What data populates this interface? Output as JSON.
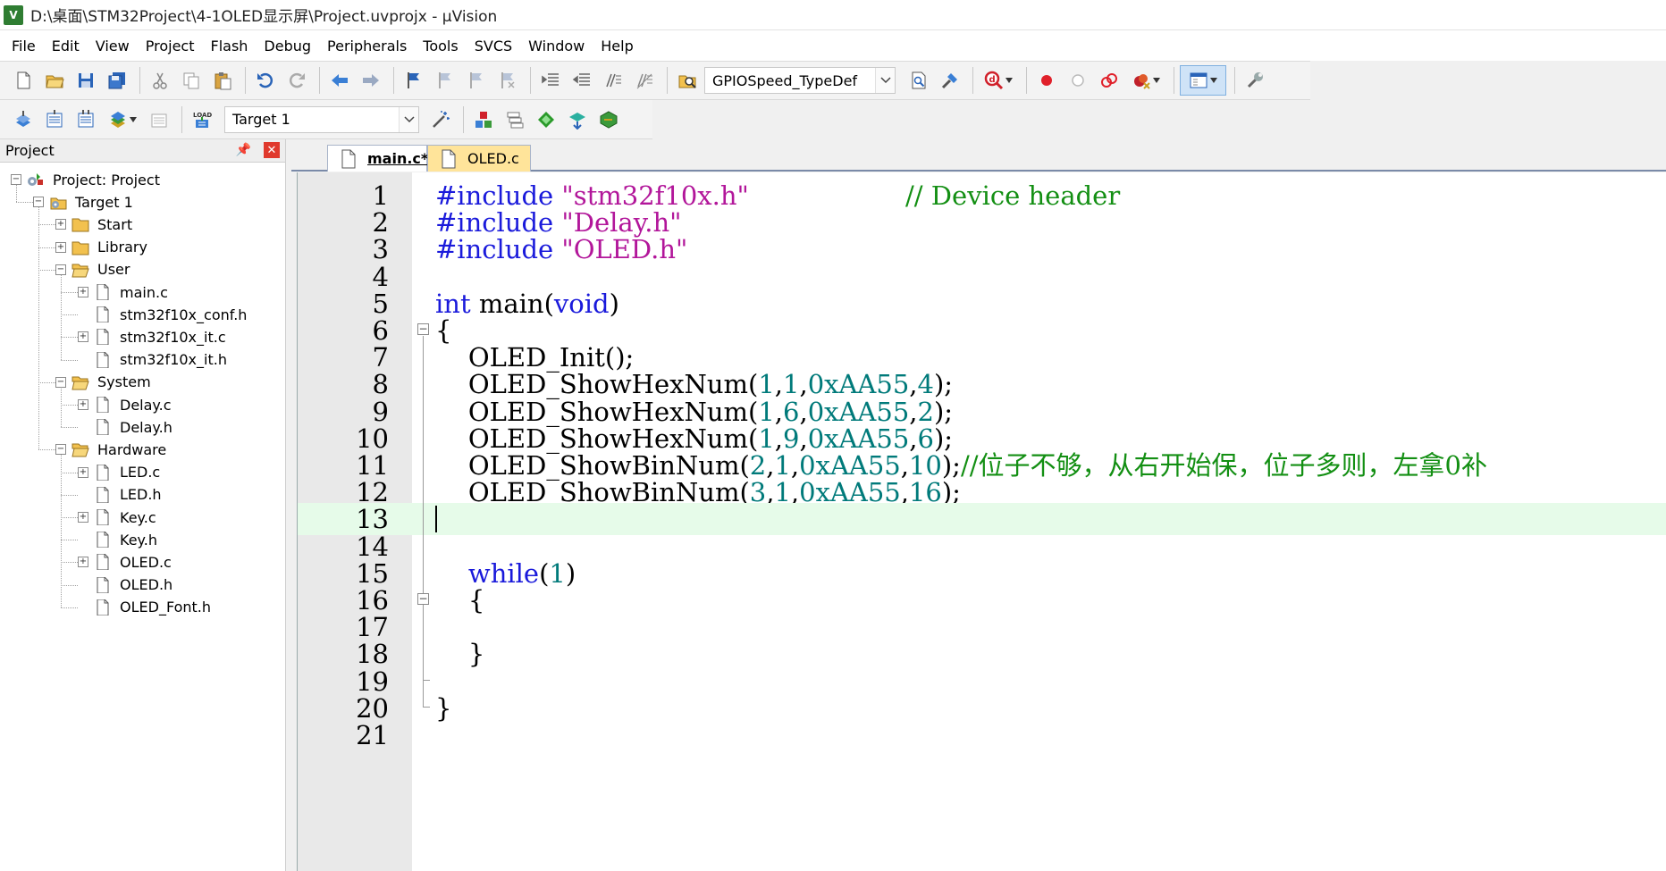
{
  "window": {
    "logo_text": "V",
    "title": "D:\\桌面\\STM32Project\\4-1OLED显示屏\\Project.uvprojx - µVision"
  },
  "menu": [
    "File",
    "Edit",
    "View",
    "Project",
    "Flash",
    "Debug",
    "Peripherals",
    "Tools",
    "SVCS",
    "Window",
    "Help"
  ],
  "toolbar": {
    "find_combo_value": "GPIOSpeed_TypeDef",
    "target_combo_value": "Target 1"
  },
  "project_panel": {
    "title": "Project",
    "close": "✕",
    "tree": [
      {
        "label": "Project: Project",
        "level": 0,
        "type": "project",
        "expander": "−"
      },
      {
        "label": "Target 1",
        "level": 1,
        "type": "target",
        "expander": "−"
      },
      {
        "label": "Start",
        "level": 2,
        "type": "folder",
        "expander": "+"
      },
      {
        "label": "Library",
        "level": 2,
        "type": "folder",
        "expander": "+"
      },
      {
        "label": "User",
        "level": 2,
        "type": "folder-open",
        "expander": "−"
      },
      {
        "label": "main.c",
        "level": 3,
        "type": "file",
        "expander": "+"
      },
      {
        "label": "stm32f10x_conf.h",
        "level": 3,
        "type": "file",
        "expander": ""
      },
      {
        "label": "stm32f10x_it.c",
        "level": 3,
        "type": "file",
        "expander": "+"
      },
      {
        "label": "stm32f10x_it.h",
        "level": 3,
        "type": "file",
        "expander": ""
      },
      {
        "label": "System",
        "level": 2,
        "type": "folder-open",
        "expander": "−"
      },
      {
        "label": "Delay.c",
        "level": 3,
        "type": "file",
        "expander": "+"
      },
      {
        "label": "Delay.h",
        "level": 3,
        "type": "file",
        "expander": ""
      },
      {
        "label": "Hardware",
        "level": 2,
        "type": "folder-open",
        "expander": "−"
      },
      {
        "label": "LED.c",
        "level": 3,
        "type": "file",
        "expander": "+"
      },
      {
        "label": "LED.h",
        "level": 3,
        "type": "file",
        "expander": ""
      },
      {
        "label": "Key.c",
        "level": 3,
        "type": "file",
        "expander": "+"
      },
      {
        "label": "Key.h",
        "level": 3,
        "type": "file",
        "expander": ""
      },
      {
        "label": "OLED.c",
        "level": 3,
        "type": "file",
        "expander": "+"
      },
      {
        "label": "OLED.h",
        "level": 3,
        "type": "file",
        "expander": ""
      },
      {
        "label": "OLED_Font.h",
        "level": 3,
        "type": "file",
        "expander": ""
      }
    ]
  },
  "editor": {
    "tabs": [
      {
        "label": "main.c*",
        "active": true
      },
      {
        "label": "OLED.c",
        "active": false
      }
    ],
    "current_line": 13,
    "lines": [
      [
        [
          "pp",
          "#include "
        ],
        [
          "str",
          "\"stm32f10x.h\""
        ],
        [
          "cmt",
          "                   // Device header"
        ]
      ],
      [
        [
          "pp",
          "#include "
        ],
        [
          "str",
          "\"Delay.h\""
        ]
      ],
      [
        [
          "pp",
          "#include "
        ],
        [
          "str",
          "\"OLED.h\""
        ]
      ],
      [],
      [
        [
          "kw",
          "int"
        ],
        [
          "fn",
          " main"
        ],
        [
          "op",
          "("
        ],
        [
          "kw",
          "void"
        ],
        [
          "op",
          ")"
        ]
      ],
      [
        [
          "op",
          "{"
        ]
      ],
      [
        [
          "fn",
          "    OLED_Init"
        ],
        [
          "op",
          "();"
        ]
      ],
      [
        [
          "fn",
          "    OLED_ShowHexNum"
        ],
        [
          "op",
          "("
        ],
        [
          "num",
          "1"
        ],
        [
          "op",
          ","
        ],
        [
          "num",
          "1"
        ],
        [
          "op",
          ","
        ],
        [
          "num",
          "0xAA55"
        ],
        [
          "op",
          ","
        ],
        [
          "num",
          "4"
        ],
        [
          "op",
          ");"
        ]
      ],
      [
        [
          "fn",
          "    OLED_ShowHexNum"
        ],
        [
          "op",
          "("
        ],
        [
          "num",
          "1"
        ],
        [
          "op",
          ","
        ],
        [
          "num",
          "6"
        ],
        [
          "op",
          ","
        ],
        [
          "num",
          "0xAA55"
        ],
        [
          "op",
          ","
        ],
        [
          "num",
          "2"
        ],
        [
          "op",
          ");"
        ]
      ],
      [
        [
          "fn",
          "    OLED_ShowHexNum"
        ],
        [
          "op",
          "("
        ],
        [
          "num",
          "1"
        ],
        [
          "op",
          ","
        ],
        [
          "num",
          "9"
        ],
        [
          "op",
          ","
        ],
        [
          "num",
          "0xAA55"
        ],
        [
          "op",
          ","
        ],
        [
          "num",
          "6"
        ],
        [
          "op",
          ");"
        ]
      ],
      [
        [
          "fn",
          "    OLED_ShowBinNum"
        ],
        [
          "op",
          "("
        ],
        [
          "num",
          "2"
        ],
        [
          "op",
          ","
        ],
        [
          "num",
          "1"
        ],
        [
          "op",
          ","
        ],
        [
          "num",
          "0xAA55"
        ],
        [
          "op",
          ","
        ],
        [
          "num",
          "10"
        ],
        [
          "op",
          ");"
        ],
        [
          "cmt",
          "//位子不够，从右开始保，位子多则，左拿0补"
        ]
      ],
      [
        [
          "fn",
          "    OLED_ShowBinNum"
        ],
        [
          "op",
          "("
        ],
        [
          "num",
          "3"
        ],
        [
          "op",
          ","
        ],
        [
          "num",
          "1"
        ],
        [
          "op",
          ","
        ],
        [
          "num",
          "0xAA55"
        ],
        [
          "op",
          ","
        ],
        [
          "num",
          "16"
        ],
        [
          "op",
          ");"
        ]
      ],
      [],
      [],
      [
        [
          "kw",
          "    while"
        ],
        [
          "op",
          "("
        ],
        [
          "num",
          "1"
        ],
        [
          "op",
          ")"
        ]
      ],
      [
        [
          "op",
          "    {"
        ]
      ],
      [],
      [
        [
          "op",
          "    }"
        ]
      ],
      [],
      [
        [
          "op",
          "}"
        ]
      ],
      []
    ]
  },
  "colors": {
    "keyword": "#1a1adb",
    "string": "#b2169a",
    "comment": "#138f13",
    "number": "#007a7a",
    "current_line": "#e6fbe9",
    "active_tab": "#ffffff",
    "inactive_tab": "#ffe49a"
  }
}
